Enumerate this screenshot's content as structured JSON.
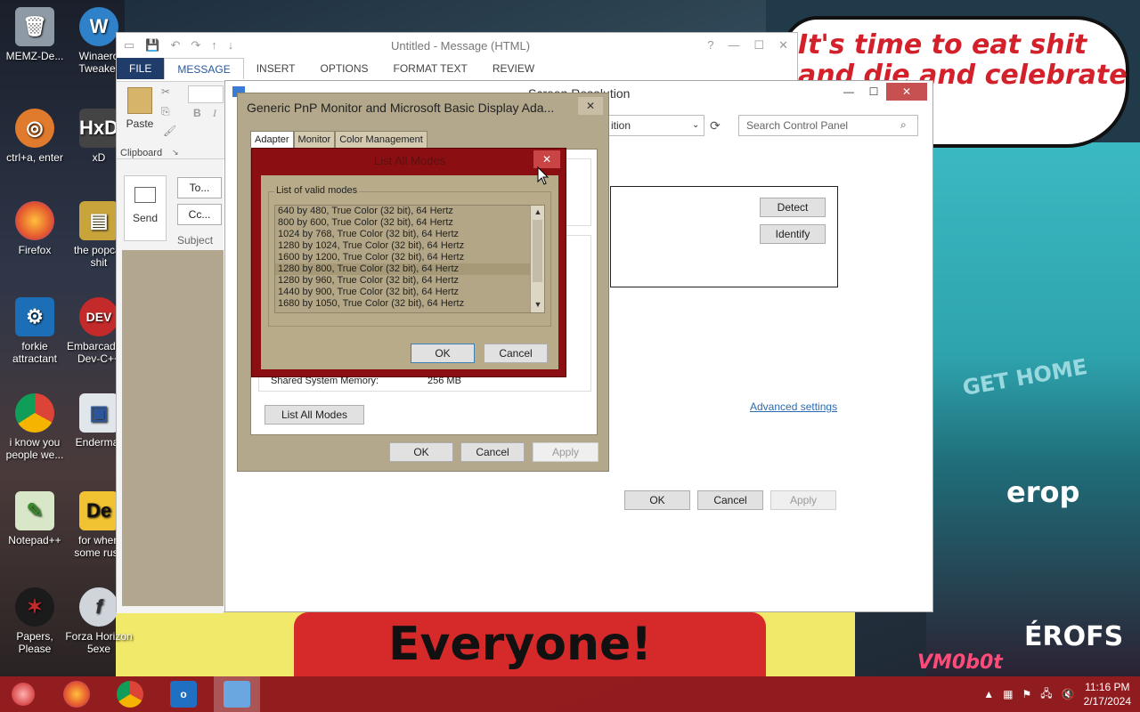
{
  "wallpaper": {
    "speech_text": "It's time to eat shit and die and celebrate year",
    "banner_text": "Everyone!",
    "right_texts": [
      "GET HOME",
      "erop",
      "ÉROFS",
      "VM0b0t"
    ]
  },
  "desktop_icons": [
    {
      "label": "MEMZ-De...",
      "icon": "recycle-bin-icon"
    },
    {
      "label": "Winaero Tweaker",
      "icon": "winaero-icon"
    },
    {
      "label": "ctrl+a, enter",
      "icon": "fish-icon"
    },
    {
      "label": "xD",
      "icon": "hxd-icon"
    },
    {
      "label": "Firefox",
      "icon": "firefox-icon"
    },
    {
      "label": "the popcat shit",
      "icon": "folder-icon"
    },
    {
      "label": "forkie attractant",
      "icon": "settings-icon"
    },
    {
      "label": "Embarcadero Dev-C++",
      "icon": "devcpp-icon"
    },
    {
      "label": "i know you people we...",
      "icon": "chrome-icon"
    },
    {
      "label": "Endermar",
      "icon": "app-icon"
    },
    {
      "label": "Notepad++",
      "icon": "notepad-icon"
    },
    {
      "label": "for when some russ",
      "icon": "pdf-icon"
    },
    {
      "label": "Papers, Please",
      "icon": "papers-icon"
    },
    {
      "label": "Forza Horizon 5exe",
      "icon": "flash-icon"
    }
  ],
  "outlook": {
    "title": "Untitled - Message (HTML)",
    "tabs": [
      "FILE",
      "MESSAGE",
      "INSERT",
      "OPTIONS",
      "FORMAT TEXT",
      "REVIEW"
    ],
    "active_tab": "MESSAGE",
    "paste_label": "Paste",
    "clipboard_label": "Clipboard",
    "send_label": "Send",
    "to_label": "To...",
    "cc_label": "Cc...",
    "subject_label": "Subject",
    "bold": "B",
    "italic": "I"
  },
  "screen_resolution": {
    "title": "Screen Resolution",
    "address_text": "ition",
    "search_placeholder": "Search Control Panel",
    "detect_label": "Detect",
    "identify_label": "Identify",
    "advanced_link": "Advanced settings",
    "ok_label": "OK",
    "cancel_label": "Cancel",
    "apply_label": "Apply"
  },
  "props_dialog": {
    "title": "Generic PnP Monitor and Microsoft Basic Display Ada...",
    "tabs": [
      "Adapter",
      "Monitor",
      "Color Management"
    ],
    "active_tab": "Adapter",
    "memory_label": "Shared System Memory:",
    "memory_value": "256 MB",
    "list_all_modes_label": "List All Modes",
    "ok_label": "OK",
    "cancel_label": "Cancel",
    "apply_label": "Apply"
  },
  "list_all_modes": {
    "title": "List All Modes",
    "group_label": "List of valid modes",
    "modes": [
      "640 by 480, True Color (32 bit), 64 Hertz",
      "800 by 600, True Color (32 bit), 64 Hertz",
      "1024 by 768, True Color (32 bit), 64 Hertz",
      "1280 by 1024, True Color (32 bit), 64 Hertz",
      "1600 by 1200, True Color (32 bit), 64 Hertz",
      "1280 by 800, True Color (32 bit), 64 Hertz",
      "1280 by 960, True Color (32 bit), 64 Hertz",
      "1440 by 900, True Color (32 bit), 64 Hertz",
      "1680 by 1050, True Color (32 bit), 64 Hertz"
    ],
    "selected_index": 5,
    "ok_label": "OK",
    "cancel_label": "Cancel"
  },
  "taskbar": {
    "apps": [
      "start-orb-icon",
      "firefox-icon",
      "chrome-icon",
      "outlook-icon",
      "control-panel-icon"
    ],
    "time": "11:16 PM",
    "date": "2/17/2024"
  },
  "colors": {
    "taskbar": "#961c1e",
    "dialog_red": "#8b0f12",
    "dialog_body": "#b8ab89",
    "outlook_file_tab": "#1f3c6b",
    "link": "#2b6cb0"
  }
}
